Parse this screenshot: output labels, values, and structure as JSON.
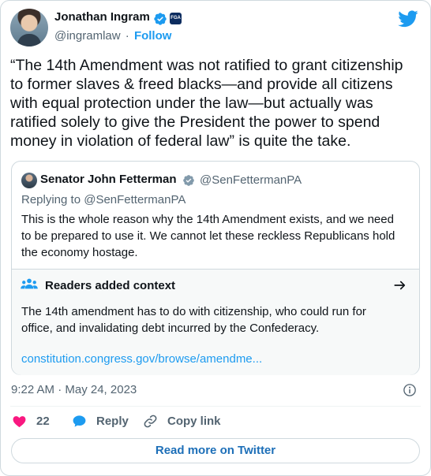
{
  "author": {
    "name": "Jonathan Ingram",
    "handle": "@ingramlaw",
    "separator": "·",
    "follow_label": "Follow",
    "affiliation_badge": "FGA"
  },
  "tweet": {
    "text": "“The 14th Amendment was not ratified to grant citizenship\nto former slaves & freed blacks—and provide all citizens\nwith equal protection under the law—but actually was\nratified solely to give the President the power to spend\nmoney in violation of federal law” is quite the take.",
    "timestamp": "9:22 AM · May 24, 2023"
  },
  "quoted_tweet": {
    "name": "Senator John Fetterman",
    "handle": "@SenFettermanPA",
    "replying_to": "Replying to @SenFettermanPA",
    "text": "This is the whole reason why the 14th Amendment exists, and we need\nto be prepared to use it. We cannot let these reckless Republicans hold\nthe economy hostage.",
    "context": {
      "title": "Readers added context",
      "text": "The 14th amendment has to do with citizenship, who could run for\noffice, and invalidating debt incurred by the Confederacy.",
      "link": "constitution.congress.gov/browse/amendme..."
    }
  },
  "actions": {
    "like_count": "22",
    "reply_label": "Reply",
    "copy_label": "Copy link"
  },
  "read_more_label": "Read more on Twitter",
  "colors": {
    "accent": "#1d9bf0",
    "like": "#f91880",
    "text": "#0f1419",
    "muted": "#536471",
    "border": "#cfd9de"
  },
  "icons": [
    "verified-icon",
    "twitter-logo-icon",
    "people-icon",
    "arrow-right-icon",
    "info-icon",
    "heart-icon",
    "reply-icon",
    "link-icon"
  ]
}
